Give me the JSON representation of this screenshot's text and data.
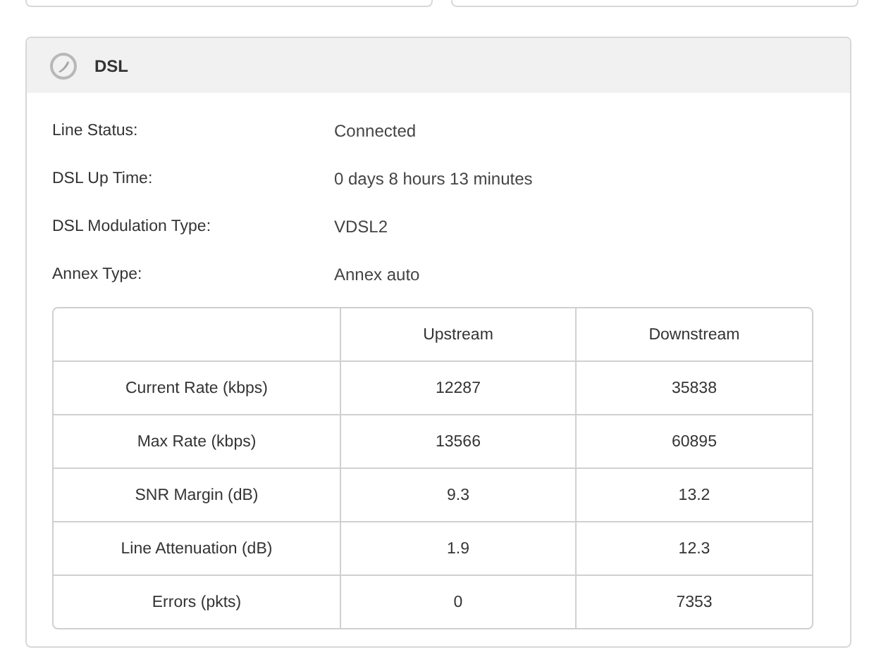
{
  "panel": {
    "title": "DSL"
  },
  "info": [
    {
      "label": "Line Status:",
      "value": "Connected"
    },
    {
      "label": "DSL Up Time:",
      "value": "0 days 8 hours 13 minutes"
    },
    {
      "label": "DSL Modulation Type:",
      "value": "VDSL2"
    },
    {
      "label": "Annex Type:",
      "value": "Annex auto"
    }
  ],
  "table": {
    "columns": [
      "",
      "Upstream",
      "Downstream"
    ],
    "rows": [
      [
        "Current Rate (kbps)",
        "12287",
        "35838"
      ],
      [
        "Max Rate (kbps)",
        "13566",
        "60895"
      ],
      [
        "SNR Margin (dB)",
        "9.3",
        "13.2"
      ],
      [
        "Line Attenuation (dB)",
        "1.9",
        "12.3"
      ],
      [
        "Errors (pkts)",
        "0",
        "7353"
      ]
    ]
  }
}
